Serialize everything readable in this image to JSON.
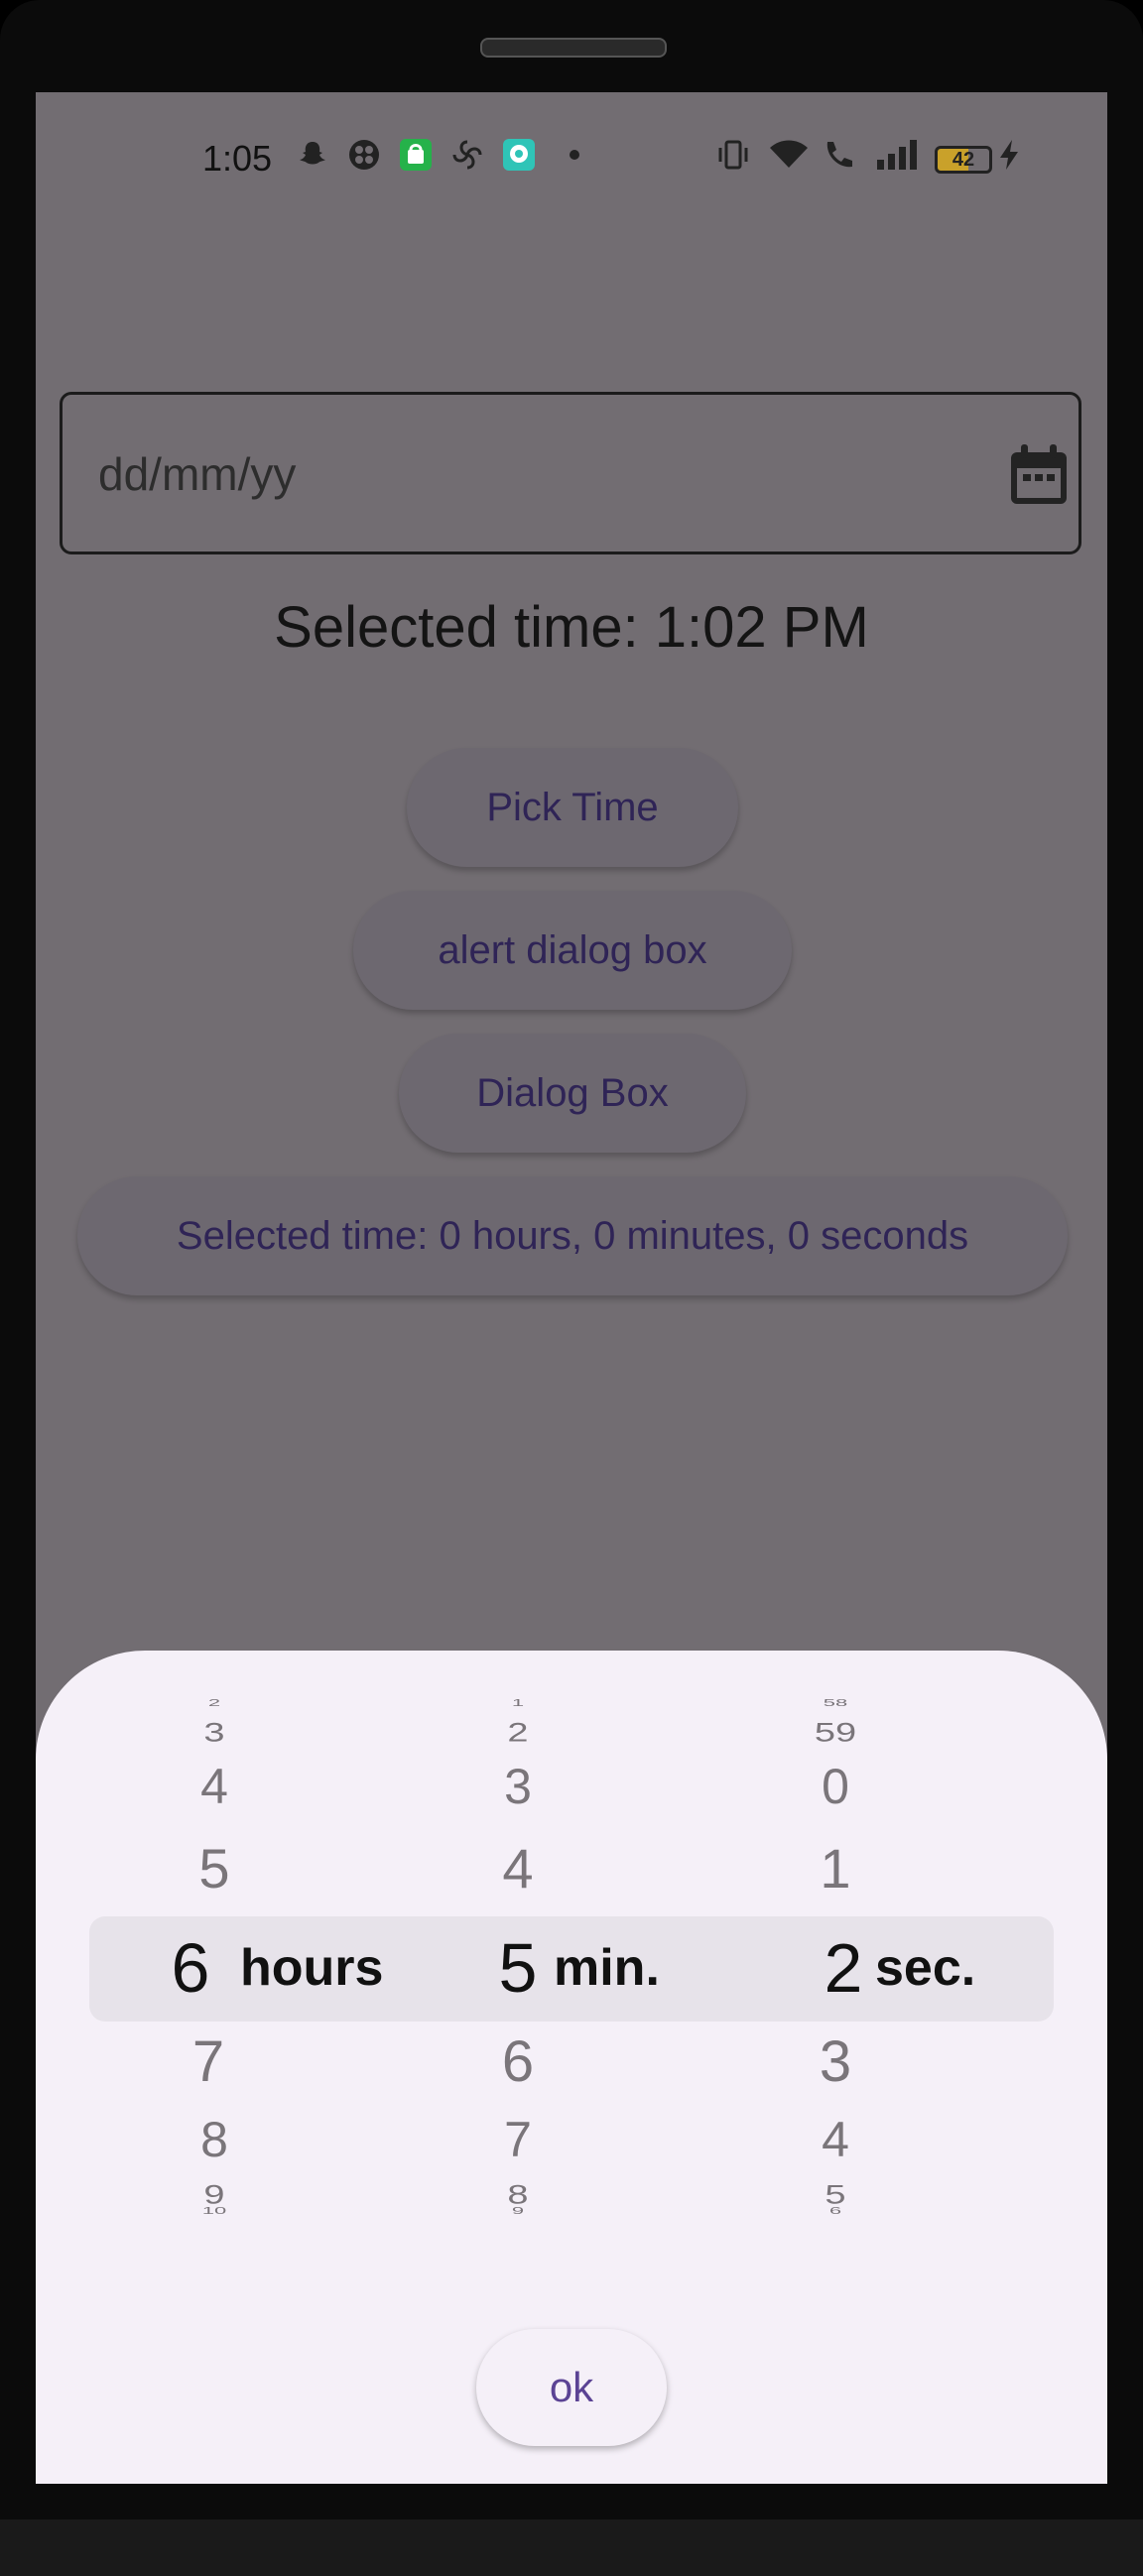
{
  "status_bar": {
    "time": "1:05",
    "battery": "42",
    "icons": [
      "snapchat-icon",
      "app-icon",
      "shopping-icon",
      "pinwheel-icon",
      "chat-icon",
      "dot-icon",
      "vibrate-icon",
      "wifi-icon",
      "call-icon",
      "signal-icon",
      "charging-icon"
    ]
  },
  "date_field": {
    "placeholder": "dd/mm/yy",
    "icon": "calendar-icon"
  },
  "selected_time_label": "Selected time: 1:02 PM",
  "buttons": {
    "pick_time": "Pick Time",
    "alert_dialog": "alert dialog box",
    "dialog_box": "Dialog Box",
    "duration": "Selected time: 0 hours, 0 minutes, 0 seconds"
  },
  "duration_picker": {
    "hours": {
      "above": [
        "2",
        "3",
        "4",
        "5"
      ],
      "selected": "6",
      "below": [
        "7",
        "8",
        "9",
        "10"
      ],
      "unit": "hours"
    },
    "minutes": {
      "above": [
        "1",
        "2",
        "3",
        "4"
      ],
      "selected": "5",
      "below": [
        "6",
        "7",
        "8",
        "9"
      ],
      "unit": "min."
    },
    "seconds": {
      "above": [
        "58",
        "59",
        "0",
        "1"
      ],
      "selected": "2",
      "below": [
        "3",
        "4",
        "5",
        "6"
      ],
      "unit": "sec."
    },
    "ok_label": "ok"
  }
}
